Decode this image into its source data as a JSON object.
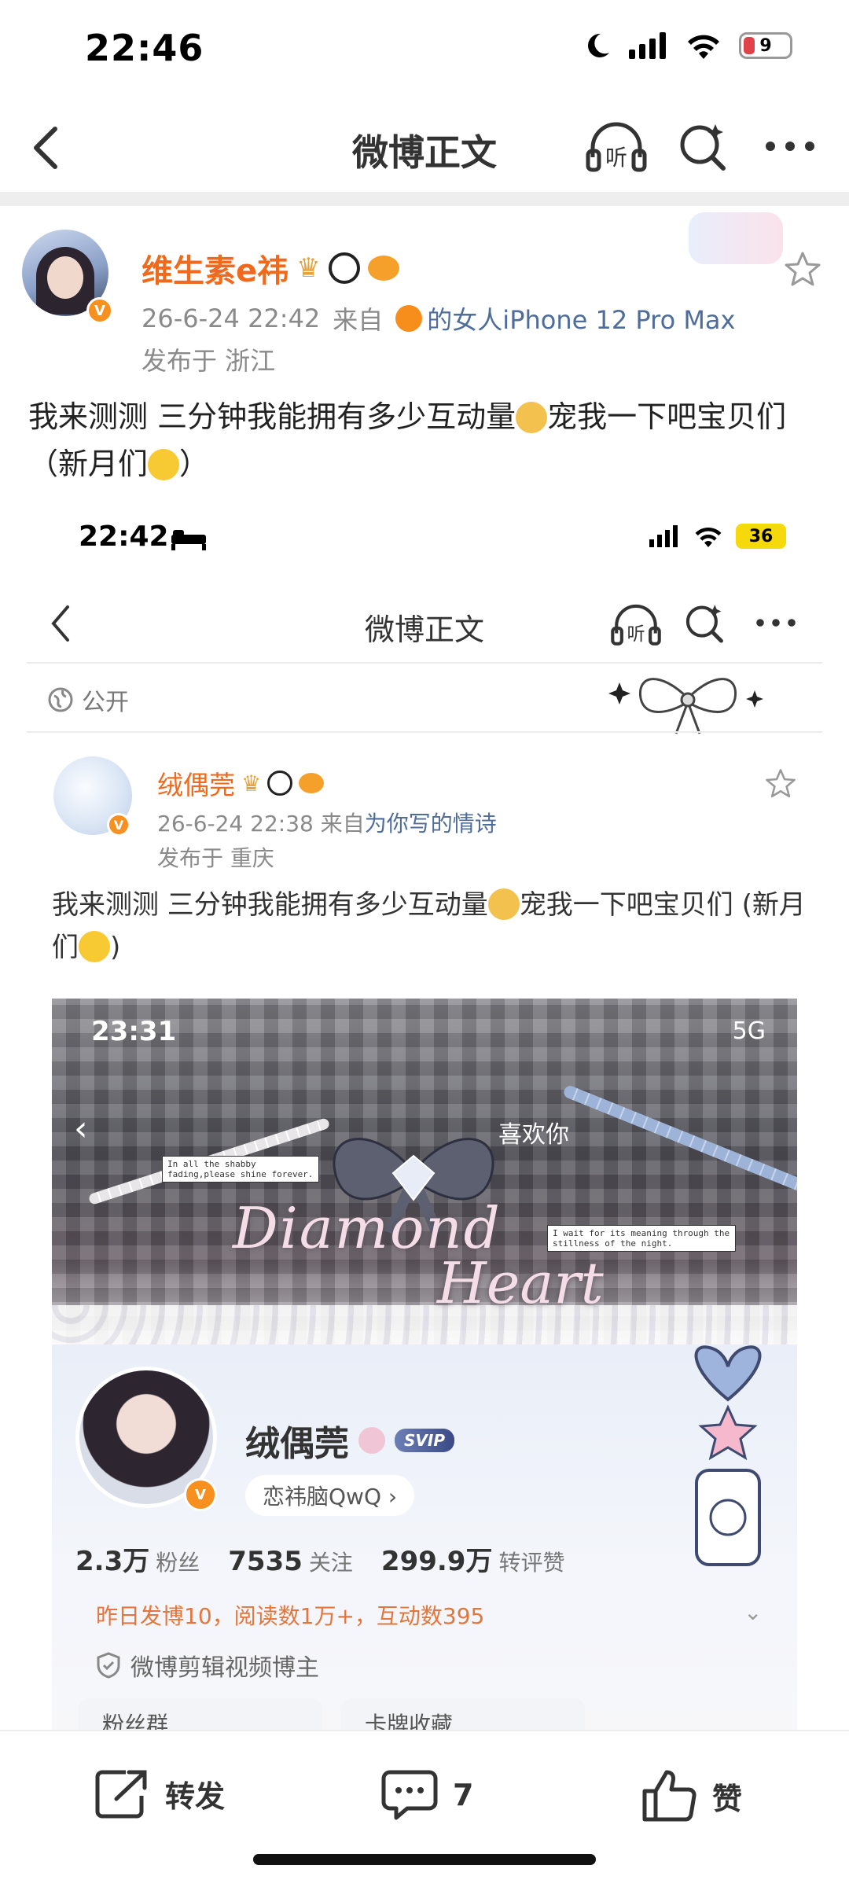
{
  "status_bar": {
    "time": "22:46",
    "battery": "9"
  },
  "nav": {
    "title": "微博正文",
    "listen_label": "听"
  },
  "post": {
    "username": "维生素e祎",
    "time": "26-6-24 22:42",
    "from_label": "来自",
    "source": "的女人iPhone 12 Pro Max",
    "location": "发布于 浙江",
    "text_part1": "我来测测 三分钟我能拥有多少互动量",
    "text_part2": "宠我一下吧宝贝们 （新月们",
    "text_part3": "）"
  },
  "embedded": {
    "status_time": "22:42",
    "battery": "36",
    "nav_title": "微博正文",
    "listen_label": "听",
    "visibility": "公开",
    "username": "绒偶莞",
    "time": "26-6-24 22:38",
    "from_label": "来自",
    "source": "为你写的情诗",
    "location": "发布于 重庆",
    "text_part1": "我来测测 三分钟我能拥有多少互动量",
    "text_part2": "宠我一下吧宝贝们 (新月们",
    "text_part3": ")"
  },
  "inner_profile": {
    "status_time": "23:31",
    "signal": "5G",
    "like_label": "喜欢你",
    "banner_title_1": "Diamond",
    "banner_title_2": "Heart",
    "banner_note_1": "In all the shabby fading,please shine forever.",
    "banner_note_2": "I wait for its meaning through the stillness of the night.",
    "name": "绒偶莞",
    "svip": "SVIP",
    "tag": "恋祎脑QwQ",
    "stats": [
      {
        "value": "2.3万",
        "label": "粉丝"
      },
      {
        "value": "7535",
        "label": "关注"
      },
      {
        "value": "299.9万",
        "label": "转评赞"
      }
    ],
    "activity": "昨日发博10，阅读数1万+，互动数395",
    "certification": "微博剪辑视频博主",
    "cards": [
      "粉丝群",
      "卡牌收藏"
    ]
  },
  "bottom_bar": {
    "repost": "转发",
    "comment_count": "7",
    "like": "赞"
  },
  "colors": {
    "username": "#ef6a1c",
    "link": "#4f6d9a",
    "meta": "#8a8a8a",
    "badge": "#f7901e"
  }
}
